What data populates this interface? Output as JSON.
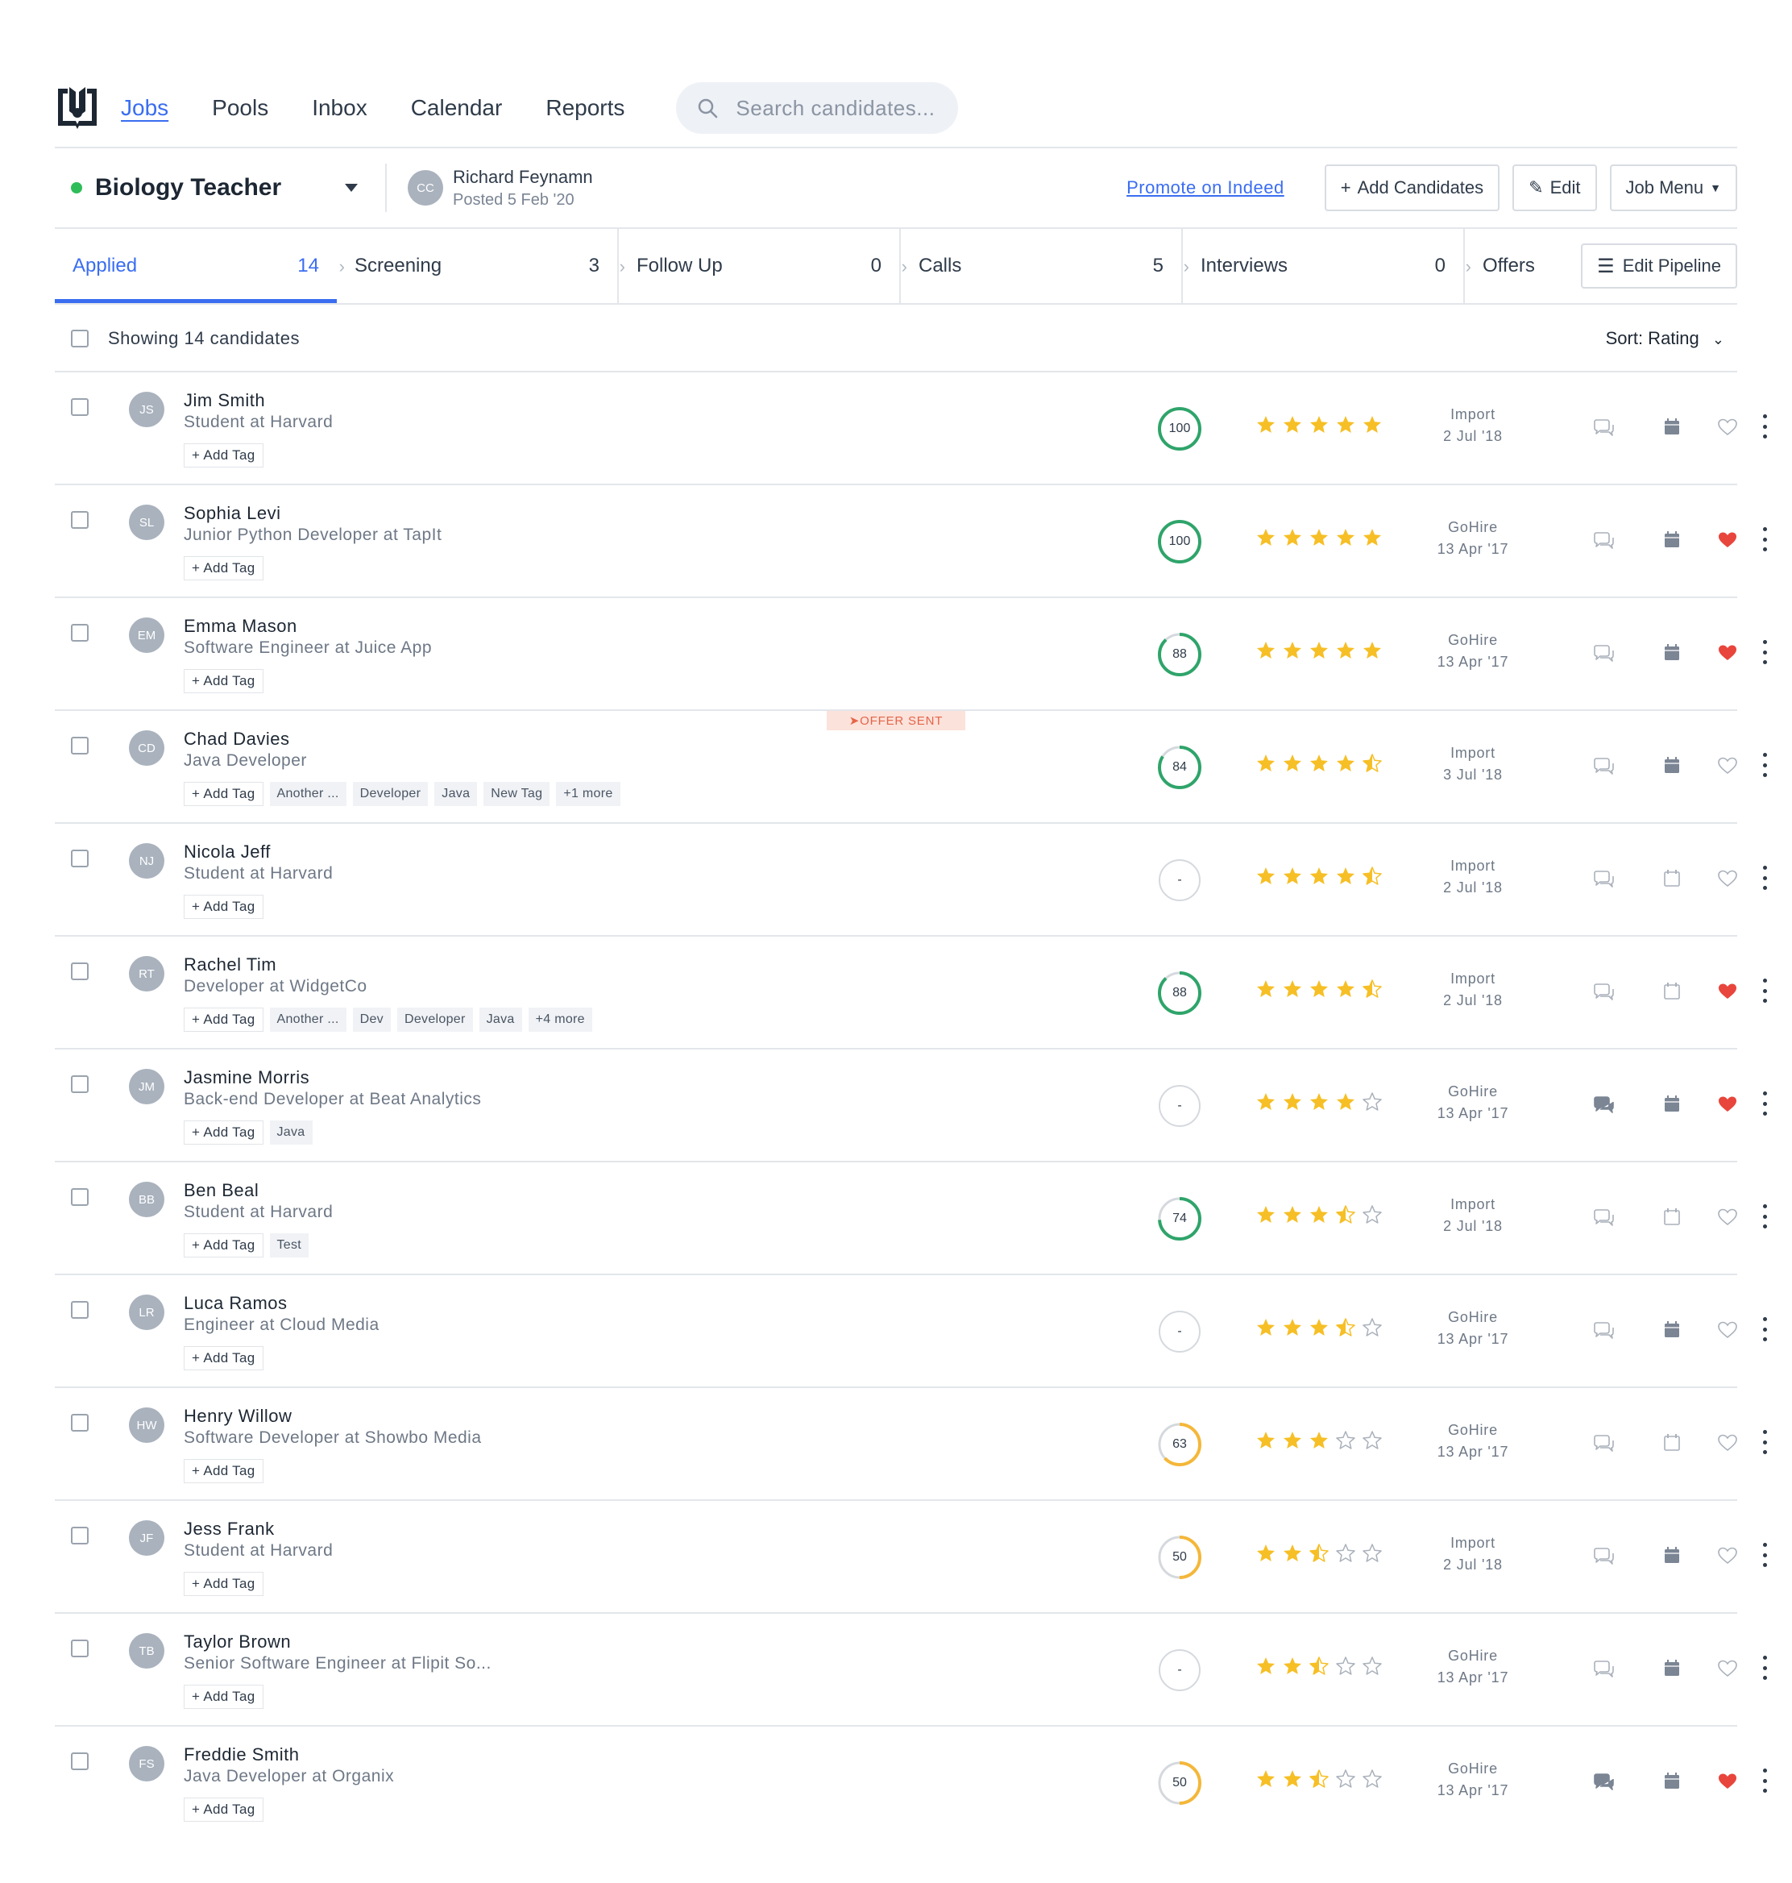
{
  "nav": {
    "items": [
      "Jobs",
      "Pools",
      "Inbox",
      "Calendar",
      "Reports"
    ],
    "active": "Jobs",
    "search_placeholder": "Search candidates..."
  },
  "job": {
    "title": "Biology Teacher",
    "status_color": "#2ebd59",
    "poster_initials": "CC",
    "poster_name": "Richard Feynamn",
    "posted": "Posted 5 Feb '20",
    "promote_label": "Promote on Indeed",
    "add_candidates_label": "Add Candidates",
    "edit_label": "Edit",
    "job_menu_label": "Job Menu"
  },
  "pipeline": {
    "stages": [
      {
        "label": "Applied",
        "count": "14"
      },
      {
        "label": "Screening",
        "count": "3"
      },
      {
        "label": "Follow Up",
        "count": "0"
      },
      {
        "label": "Calls",
        "count": "5"
      },
      {
        "label": "Interviews",
        "count": "0"
      },
      {
        "label": "Offers",
        "count": ""
      }
    ],
    "active_stage": "Applied",
    "edit_pipeline_label": "Edit Pipeline"
  },
  "list": {
    "showing_label": "Showing 14 candidates",
    "sort_label": "Sort: Rating"
  },
  "colors": {
    "accent": "#3a6df0",
    "score_green": "#2fa46a",
    "score_yellow": "#f4b73a",
    "star": "#f6bf26",
    "heart": "#e8453c",
    "offer_bg": "#fbe2da",
    "offer_text": "#e5644a"
  },
  "candidates": [
    {
      "initials": "JS",
      "name": "Jim Smith",
      "subtitle": "Student at Harvard",
      "tags": [],
      "score": "100",
      "score_fraction": 1.0,
      "score_color": "green",
      "rating": 5,
      "source": "Import",
      "date": "2 Jul '18",
      "msg_filled": false,
      "cal_filled": true,
      "fav": false,
      "offer": ""
    },
    {
      "initials": "SL",
      "name": "Sophia Levi",
      "subtitle": "Junior Python Developer at TapIt",
      "tags": [],
      "score": "100",
      "score_fraction": 1.0,
      "score_color": "green",
      "rating": 5,
      "source": "GoHire",
      "date": "13 Apr '17",
      "msg_filled": false,
      "cal_filled": true,
      "fav": true,
      "offer": ""
    },
    {
      "initials": "EM",
      "name": "Emma Mason",
      "subtitle": "Software Engineer at Juice App",
      "tags": [],
      "score": "88",
      "score_fraction": 0.88,
      "score_color": "green",
      "rating": 5,
      "source": "GoHire",
      "date": "13 Apr '17",
      "msg_filled": false,
      "cal_filled": true,
      "fav": true,
      "offer": ""
    },
    {
      "initials": "CD",
      "name": "Chad Davies",
      "subtitle": "Java Developer",
      "tags": [
        "Another ...",
        "Developer",
        "Java",
        "New Tag",
        "+1 more"
      ],
      "score": "84",
      "score_fraction": 0.84,
      "score_color": "green",
      "rating": 4.5,
      "source": "Import",
      "date": "3 Jul '18",
      "msg_filled": false,
      "cal_filled": true,
      "fav": false,
      "offer": "OFFER SENT"
    },
    {
      "initials": "NJ",
      "name": "Nicola Jeff",
      "subtitle": "Student at Harvard",
      "tags": [],
      "score": "-",
      "score_fraction": 0,
      "score_color": "none",
      "rating": 4.5,
      "source": "Import",
      "date": "2 Jul '18",
      "msg_filled": false,
      "cal_filled": false,
      "fav": false,
      "offer": ""
    },
    {
      "initials": "RT",
      "name": "Rachel Tim",
      "subtitle": "Developer at WidgetCo",
      "tags": [
        "Another ...",
        "Dev",
        "Developer",
        "Java",
        "+4 more"
      ],
      "score": "88",
      "score_fraction": 0.88,
      "score_color": "green",
      "rating": 4.5,
      "source": "Import",
      "date": "2 Jul '18",
      "msg_filled": false,
      "cal_filled": false,
      "fav": true,
      "offer": ""
    },
    {
      "initials": "JM",
      "name": "Jasmine Morris",
      "subtitle": "Back-end Developer at Beat Analytics",
      "tags": [
        "Java"
      ],
      "score": "-",
      "score_fraction": 0,
      "score_color": "none",
      "rating": 4,
      "source": "GoHire",
      "date": "13 Apr '17",
      "msg_filled": true,
      "cal_filled": true,
      "fav": true,
      "offer": ""
    },
    {
      "initials": "BB",
      "name": "Ben Beal",
      "subtitle": "Student at Harvard",
      "tags": [
        "Test"
      ],
      "score": "74",
      "score_fraction": 0.74,
      "score_color": "green",
      "rating": 3.5,
      "source": "Import",
      "date": "2 Jul '18",
      "msg_filled": false,
      "cal_filled": false,
      "fav": false,
      "offer": ""
    },
    {
      "initials": "LR",
      "name": "Luca Ramos",
      "subtitle": "Engineer at Cloud Media",
      "tags": [],
      "score": "-",
      "score_fraction": 0,
      "score_color": "none",
      "rating": 3.5,
      "source": "GoHire",
      "date": "13 Apr '17",
      "msg_filled": false,
      "cal_filled": true,
      "fav": false,
      "offer": ""
    },
    {
      "initials": "HW",
      "name": "Henry Willow",
      "subtitle": "Software Developer at Showbo Media",
      "tags": [],
      "score": "63",
      "score_fraction": 0.63,
      "score_color": "yellow",
      "rating": 3,
      "source": "GoHire",
      "date": "13 Apr '17",
      "msg_filled": false,
      "cal_filled": false,
      "fav": false,
      "offer": ""
    },
    {
      "initials": "JF",
      "name": "Jess Frank",
      "subtitle": "Student at Harvard",
      "tags": [],
      "score": "50",
      "score_fraction": 0.5,
      "score_color": "yellow",
      "rating": 2.5,
      "source": "Import",
      "date": "2 Jul '18",
      "msg_filled": false,
      "cal_filled": true,
      "fav": false,
      "offer": ""
    },
    {
      "initials": "TB",
      "name": "Taylor Brown",
      "subtitle": "Senior Software Engineer at Flipit So...",
      "tags": [],
      "score": "-",
      "score_fraction": 0,
      "score_color": "none",
      "rating": 2.5,
      "source": "GoHire",
      "date": "13 Apr '17",
      "msg_filled": false,
      "cal_filled": true,
      "fav": false,
      "offer": ""
    },
    {
      "initials": "FS",
      "name": "Freddie Smith",
      "subtitle": "Java Developer at Organix",
      "tags": [],
      "score": "50",
      "score_fraction": 0.5,
      "score_color": "yellow",
      "rating": 2.5,
      "source": "GoHire",
      "date": "13 Apr '17",
      "msg_filled": true,
      "cal_filled": true,
      "fav": true,
      "offer": ""
    }
  ],
  "add_tag_label": "+ Add Tag"
}
